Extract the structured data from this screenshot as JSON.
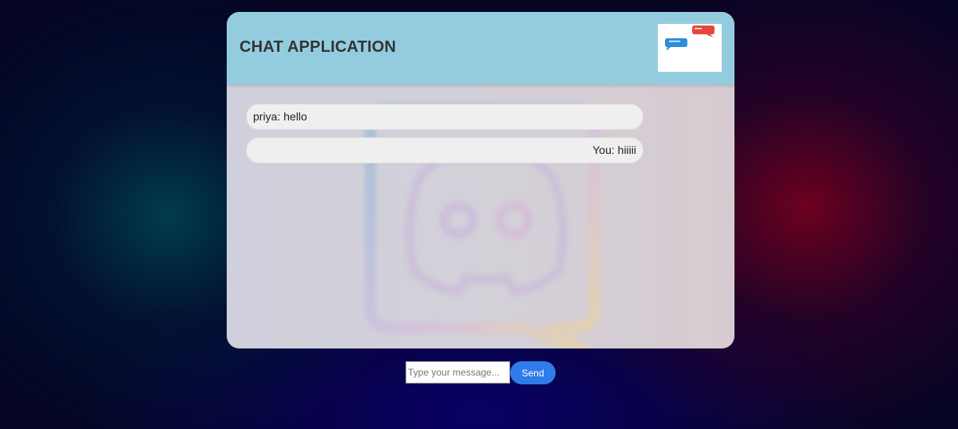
{
  "header": {
    "title": "CHAT APPLICATION",
    "logo_icon": "chat-bubbles-icon"
  },
  "messages": [
    {
      "text": "priya: hello",
      "direction": "incoming"
    },
    {
      "text": "You: hiiiii",
      "direction": "outgoing"
    }
  ],
  "background_watermark_icon": "discord-logo-icon",
  "composer": {
    "input_value": "",
    "input_placeholder": "Type your message...",
    "send_label": "Send"
  },
  "colors": {
    "header_bg": "#94ccdf",
    "send_button": "#2f7bea",
    "page_bg": "#050524"
  }
}
